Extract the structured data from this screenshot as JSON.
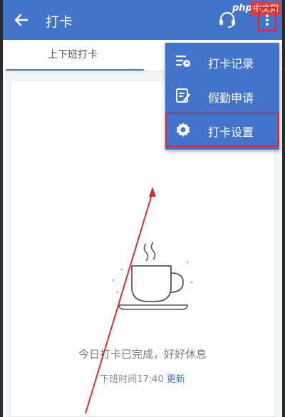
{
  "header": {
    "title": "打卡",
    "back_icon": "arrow-left-icon",
    "headset_icon": "headset-icon",
    "more_icon": "more-vertical-icon",
    "bar_color": "#4474c9"
  },
  "watermark": {
    "brand": "php",
    "site": "中文网"
  },
  "tabs": [
    {
      "label": "上下班打卡",
      "active": true
    }
  ],
  "menu": {
    "items": [
      {
        "label": "打卡记录",
        "icon": "record-list-icon"
      },
      {
        "label": "假勤申请",
        "icon": "edit-document-icon"
      },
      {
        "label": "打卡设置",
        "icon": "gear-icon"
      }
    ]
  },
  "status": {
    "message": "今日打卡已完成，好好休息",
    "off_work_label": "下班时间17:40",
    "update_link": "更新"
  },
  "annotations": {
    "highlight_color": "#e0262c"
  }
}
